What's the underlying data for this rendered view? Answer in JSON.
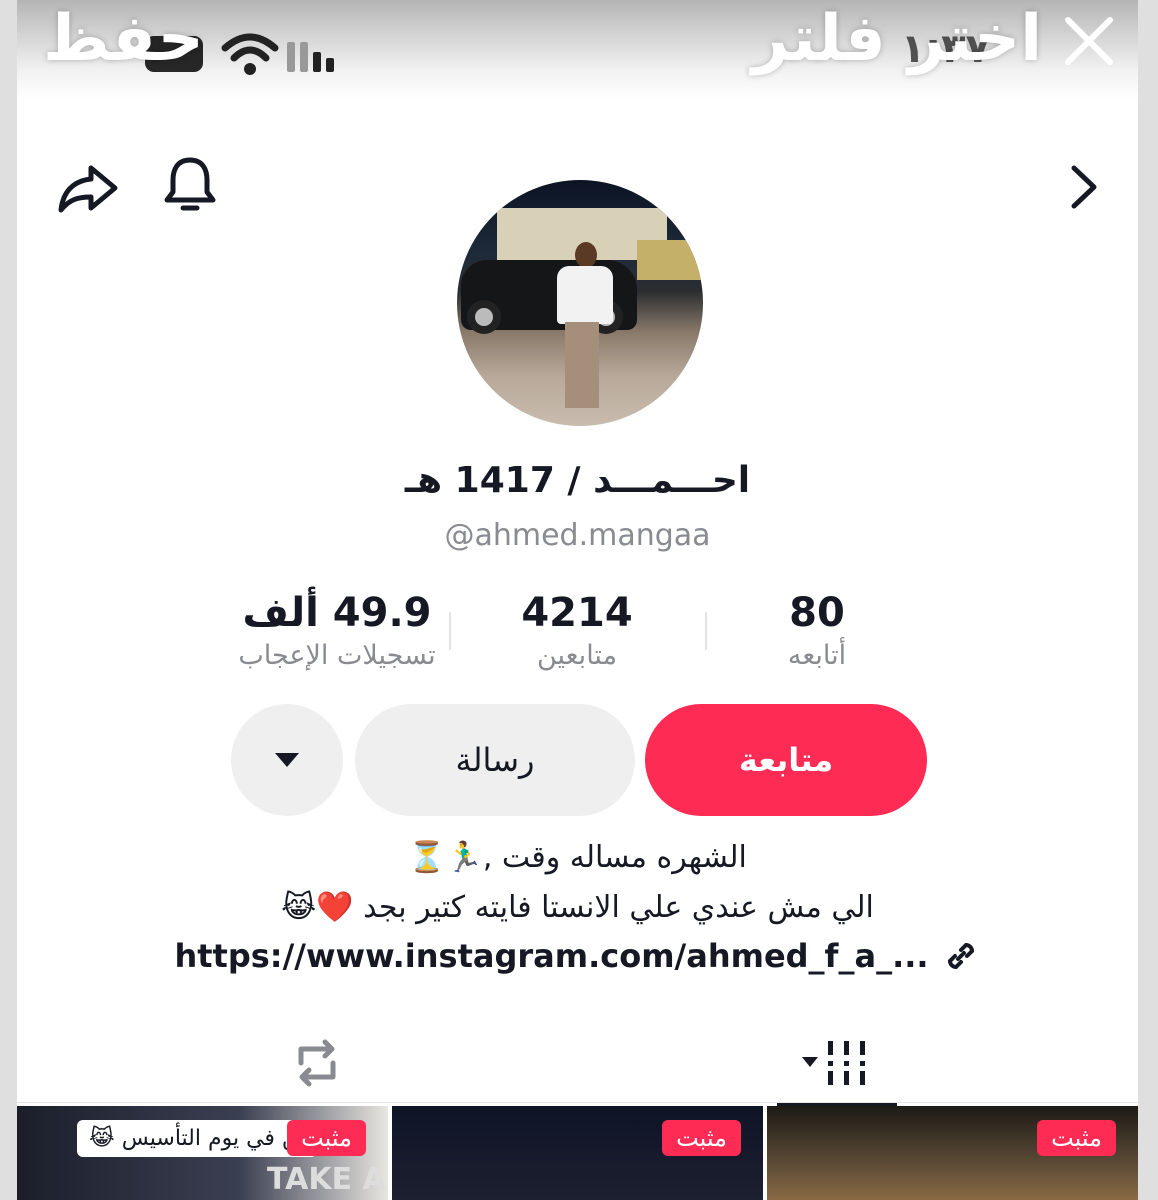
{
  "overlay": {
    "save_label": "حفظ",
    "filter_label": "اختر فلتر",
    "close_icon": "close-icon"
  },
  "status_bar": {
    "time": "١:٣٧"
  },
  "header": {
    "share_icon": "share-icon",
    "bell_icon": "bell-icon",
    "back_icon": "chevron-right-icon"
  },
  "profile": {
    "display_name": "احـــمـــد / 1417 هـ",
    "username": "@ahmed.mangaa"
  },
  "stats": [
    {
      "value": "80",
      "label": "أتابعه"
    },
    {
      "value": "4214",
      "label": "متابعين"
    },
    {
      "value": "49.9 ألف",
      "label": "تسجيلات الإعجاب"
    }
  ],
  "actions": {
    "follow_label": "متابعة",
    "message_label": "رسالة",
    "more_icon": "caret-down-icon"
  },
  "bio": {
    "line1": "الشهره مساله وقت ,🏃‍♂️⏳",
    "line2": "الي مش عندي علي الانستا فايته كتير بجد ❤️😹",
    "link": "https://www.instagram.com/ahmed_f_a_..."
  },
  "tabs": {
    "videos_icon": "grid-icon",
    "reposts_icon": "repost-icon"
  },
  "thumbnails": [
    {
      "badge": "مثبت",
      "caption": "ين في يوم التأسيس 😹",
      "sign": "TAKE A ST"
    },
    {
      "badge": "مثبت"
    },
    {
      "badge": "مثبت"
    }
  ],
  "colors": {
    "accent": "#fe2c55",
    "text": "#161823",
    "muted": "#8a8b91"
  }
}
